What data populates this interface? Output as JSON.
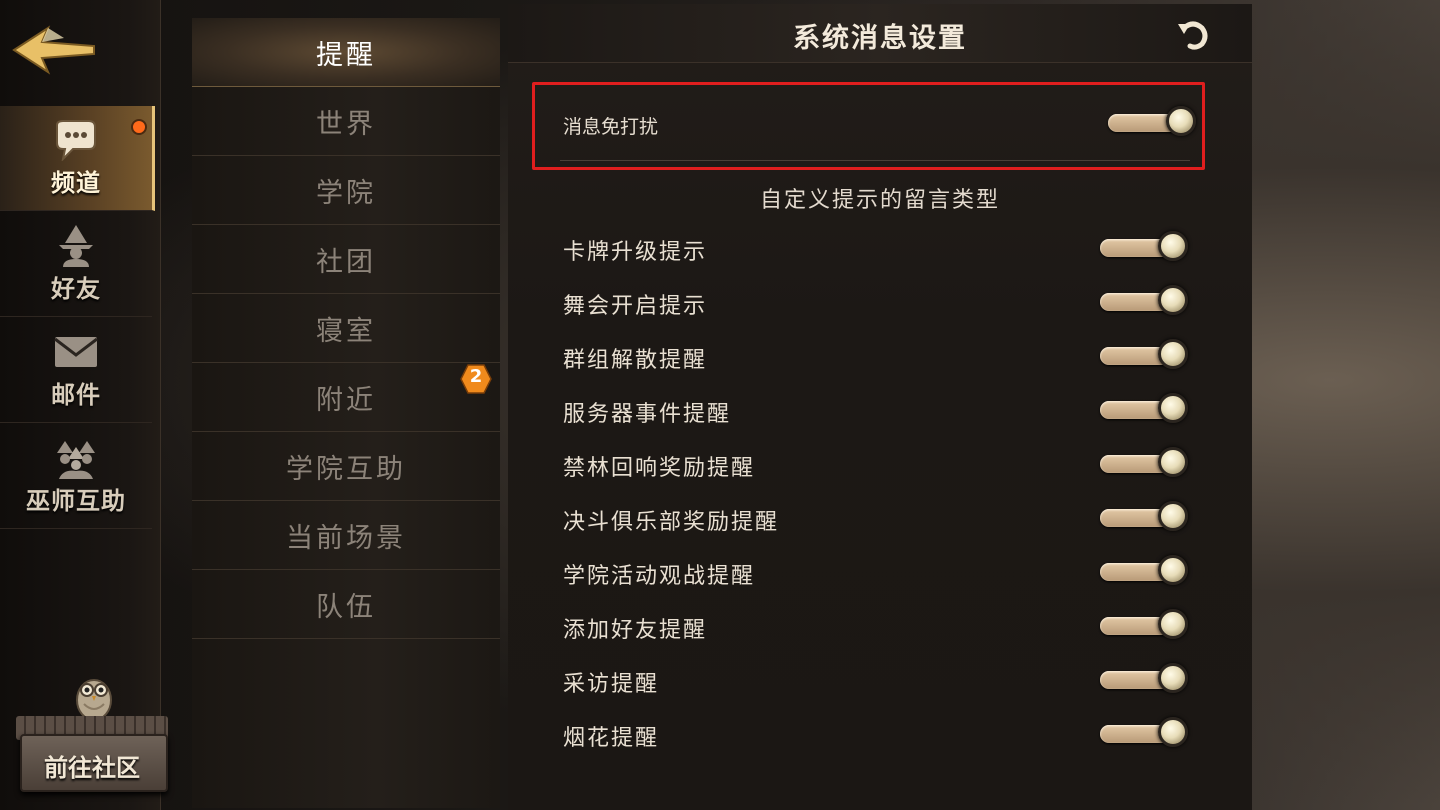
{
  "rail": {
    "items": [
      {
        "label": "频道",
        "icon": "chat-bubble-icon"
      },
      {
        "label": "好友",
        "icon": "wizard-icon"
      },
      {
        "label": "邮件",
        "icon": "envelope-icon"
      },
      {
        "label": "巫师互助",
        "icon": "wizards-group-icon"
      }
    ],
    "community_label": "前往社区"
  },
  "channels": {
    "items": [
      "提醒",
      "世界",
      "学院",
      "社团",
      "寝室",
      "附近",
      "学院互助",
      "当前场景",
      "队伍"
    ],
    "active": "提醒",
    "nearby_badge": "2"
  },
  "panel": {
    "title": "系统消息设置",
    "dnd": {
      "label": "消息免打扰",
      "on": true
    },
    "section_title": "自定义提示的留言类型",
    "rows": [
      {
        "label": "卡牌升级提示",
        "on": true
      },
      {
        "label": "舞会开启提示",
        "on": true
      },
      {
        "label": "群组解散提醒",
        "on": true
      },
      {
        "label": "服务器事件提醒",
        "on": true
      },
      {
        "label": "禁林回响奖励提醒",
        "on": true
      },
      {
        "label": "决斗俱乐部奖励提醒",
        "on": true
      },
      {
        "label": "学院活动观战提醒",
        "on": true
      },
      {
        "label": "添加好友提醒",
        "on": true
      },
      {
        "label": "采访提醒",
        "on": true
      },
      {
        "label": "烟花提醒",
        "on": true
      }
    ]
  },
  "colors": {
    "accent_gold": "#e7c47a",
    "highlight_red": "#e01e1e",
    "badge_orange": "#f08a1c",
    "toggle_track": "#d6bb96"
  }
}
